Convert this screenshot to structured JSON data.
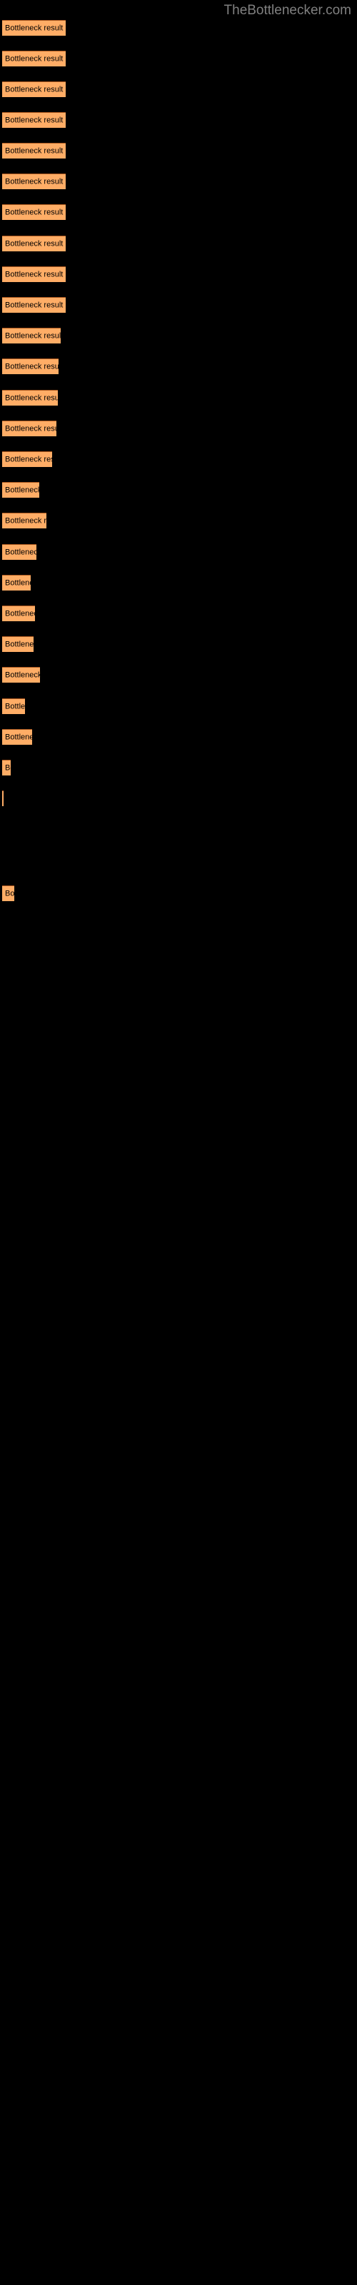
{
  "site": {
    "title": "TheBottlenecker.com",
    "title_color": "#808080"
  },
  "chart_data": {
    "type": "bar",
    "orientation": "horizontal",
    "title": "",
    "xlabel": "",
    "ylabel": "",
    "grid": false,
    "legend": false,
    "bar_color": "#ffad66",
    "bar_border_color": "#a8561e",
    "background_color": "#000000",
    "label_color": "#000000",
    "bar_label_text": "Bottleneck result",
    "categories": [
      "Bottleneck result",
      "Bottleneck result",
      "Bottleneck result",
      "Bottleneck result",
      "Bottleneck result",
      "Bottleneck result",
      "Bottleneck result",
      "Bottleneck result",
      "Bottleneck result",
      "Bottleneck result",
      "Bottleneck result",
      "Bottleneck result",
      "Bottleneck result",
      "Bottleneck result",
      "Bottleneck result",
      "Bottleneck result",
      "Bottleneck result",
      "Bottleneck result",
      "Bottleneck result",
      "Bottleneck result",
      "Bottleneck result",
      "Bottleneck result",
      "Bottleneck result",
      "Bottleneck result",
      "Bottleneck result",
      "Bottleneck result",
      "Bottleneck result",
      "Bottleneck result",
      "Bottleneck result",
      "Bottleneck result"
    ],
    "values": [
      89,
      89,
      89,
      89,
      89,
      89,
      89,
      89,
      89,
      89,
      82,
      79,
      78,
      76,
      70,
      62,
      52,
      60,
      50,
      40,
      44,
      38,
      46,
      32,
      36,
      12,
      2,
      0,
      0,
      8
    ],
    "labels_visible": [
      "Bottleneck result",
      "Bottleneck result",
      "Bottleneck result",
      "Bottleneck result",
      "Bottleneck result",
      "Bottleneck result",
      "Bottleneck result",
      "Bottleneck result",
      "Bottleneck result",
      "Bottleneck result",
      "Bottleneck result",
      "Bottleneck result",
      "Bottleneck result",
      "Bottleneck result",
      "Bottleneck resul",
      "Bottleneck",
      "Bottleneck res",
      "Bottlenec",
      "Bottlen",
      "Bottleneck",
      "Bottlene",
      "Bottleneck r",
      "Bottle",
      "Bottlenec",
      "B",
      "",
      "",
      "",
      "",
      "Bo"
    ],
    "ylim": [
      0,
      100
    ],
    "xlim": [
      0,
      100
    ]
  },
  "bars": [
    {
      "top": 28,
      "width": 89
    },
    {
      "top": 71,
      "width": 89
    },
    {
      "top": 114,
      "width": 89
    },
    {
      "top": 157,
      "width": 89
    },
    {
      "top": 200,
      "width": 89
    },
    {
      "top": 243,
      "width": 89
    },
    {
      "top": 286,
      "width": 89
    },
    {
      "top": 330,
      "width": 89
    },
    {
      "top": 373,
      "width": 89
    },
    {
      "top": 416,
      "width": 89
    },
    {
      "top": 459,
      "width": 82
    },
    {
      "top": 502,
      "width": 79
    },
    {
      "top": 546,
      "width": 78
    },
    {
      "top": 589,
      "width": 76
    },
    {
      "top": 632,
      "width": 70
    },
    {
      "top": 675,
      "width": 52
    },
    {
      "top": 718,
      "width": 62
    },
    {
      "top": 762,
      "width": 48
    },
    {
      "top": 805,
      "width": 40
    },
    {
      "top": 848,
      "width": 46
    },
    {
      "top": 891,
      "width": 44
    },
    {
      "top": 934,
      "width": 53
    },
    {
      "top": 978,
      "width": 32
    },
    {
      "top": 1021,
      "width": 42
    },
    {
      "top": 1064,
      "width": 12
    },
    {
      "top": 1107,
      "width": 2
    },
    {
      "top": 1240,
      "width": 17
    }
  ]
}
